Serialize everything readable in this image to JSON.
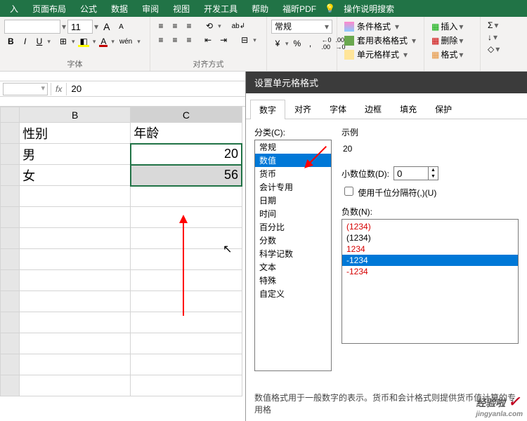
{
  "ribbon": {
    "tabs": [
      "入",
      "页面布局",
      "公式",
      "数据",
      "审阅",
      "视图",
      "开发工具",
      "帮助",
      "福昕PDF"
    ],
    "tell_me": "操作说明搜索",
    "font": {
      "name": "",
      "size": "11",
      "increase": "A",
      "decrease": "A",
      "bold": "B",
      "italic": "I",
      "underline": "U",
      "border_icon": "⊞",
      "fill_icon": "◧",
      "font_color_icon": "A",
      "phonetic": "wén",
      "group_label": "字体"
    },
    "alignment": {
      "top": "≡",
      "middle": "≡",
      "bottom": "≡",
      "orient": "⟲",
      "wrap_label": "ab↲",
      "left": "≡",
      "center": "≡",
      "right": "≡",
      "indent_dec": "⇤",
      "indent_inc": "⇥",
      "merge_label": "⊟",
      "group_label": "对齐方式"
    },
    "number": {
      "format_selected": "常规",
      "currency": "¥",
      "percent": "%",
      "comma": ",",
      "inc_dec": "←0 .00",
      "dec_dec": ".00 →0"
    },
    "styles": {
      "conditional": "条件格式",
      "table": "套用表格格式",
      "cell": "单元格样式"
    },
    "cells": {
      "insert": "插入",
      "delete": "删除",
      "format": "格式"
    },
    "editing": {
      "sum": "Σ",
      "fill": "↓",
      "clear": "◇"
    }
  },
  "formula_bar": {
    "name_box": "",
    "fx": "fx",
    "value": "20"
  },
  "sheet": {
    "col_headers": [
      "",
      "B",
      "C"
    ],
    "rows": [
      {
        "b": "性别",
        "c": "年龄"
      },
      {
        "b": "男",
        "c": "20"
      },
      {
        "b": "女",
        "c": "56"
      }
    ]
  },
  "dialog": {
    "title": "设置单元格格式",
    "tabs": [
      "数字",
      "对齐",
      "字体",
      "边框",
      "填充",
      "保护"
    ],
    "category_label": "分类(C):",
    "categories": [
      "常规",
      "数值",
      "货币",
      "会计专用",
      "日期",
      "时间",
      "百分比",
      "分数",
      "科学记数",
      "文本",
      "特殊",
      "自定义"
    ],
    "sample_label": "示例",
    "sample_value": "20",
    "decimal_label": "小数位数(D):",
    "decimal_value": "0",
    "thousands_label": "使用千位分隔符(,)(U)",
    "negatives_label": "负数(N):",
    "negatives": [
      "(1234)",
      "(1234)",
      "1234",
      "-1234",
      "-1234"
    ],
    "footer": "数值格式用于一般数字的表示。货币和会计格式则提供货币值计算的专用格"
  },
  "watermark": {
    "brand": "经验啦",
    "url": "jingyanla.com"
  },
  "icons": {
    "bulb": "💡",
    "check": "✓"
  }
}
